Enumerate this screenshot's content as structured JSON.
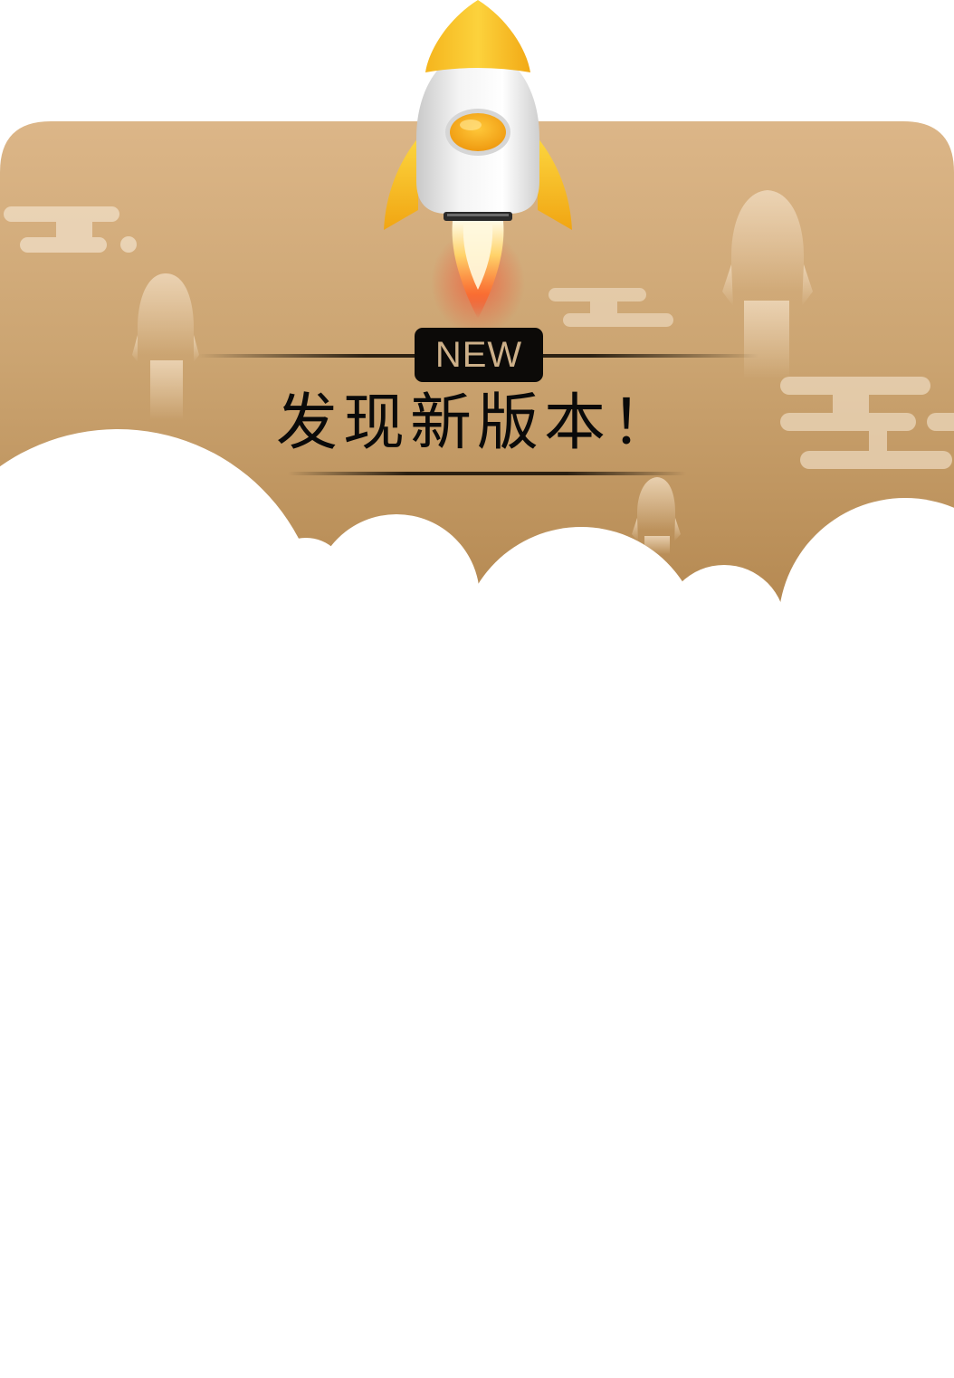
{
  "dialog": {
    "badge_text": "NEW",
    "title": "发现新版本！"
  },
  "colors": {
    "banner_top": "#d9b385",
    "banner_bottom": "#b1844c",
    "badge_background": "#0c0a08",
    "badge_text": "#cdb089",
    "title_text": "#0a0a0a",
    "rocket_nose": "#f7c22b",
    "rocket_body": "#e6e6e6",
    "rocket_window": "#f3a51b",
    "cloud": "#ffffff"
  },
  "icons": {
    "hero": "rocket-icon",
    "background": [
      "rocket-silhouette-icon",
      "cloud-stripe-icon"
    ]
  }
}
